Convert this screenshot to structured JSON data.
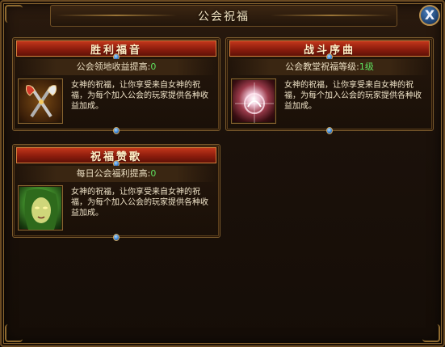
{
  "window": {
    "title": "公会祝福",
    "close_label": "X"
  },
  "panels": [
    {
      "title": "胜利福音",
      "stat_label": "公会领地收益提高:",
      "stat_value": "0",
      "description": "女神的祝福，让你享受来自女神的祝福，为每个加入公会的玩家提供各种收益加成。",
      "icon": "crossed-axes-icon"
    },
    {
      "title": "战斗序曲",
      "stat_label": "公会教堂祝福等级:",
      "stat_value": "1级",
      "description": "女神的祝福，让你享受来自女神的祝福，为每个加入公会的玩家提供各种收益加成。",
      "icon": "radiant-orb-icon"
    },
    {
      "title": "祝福赞歌",
      "stat_label": "每日公会福利提高:",
      "stat_value": "0",
      "description": "女神的祝福，让你享受来自女神的祝福，为每个加入公会的玩家提供各种收益加成。",
      "icon": "goddess-portrait-icon"
    }
  ],
  "colors": {
    "panel_header": "#a3260f",
    "stat_value": "#5fe05f",
    "border": "#8a6630"
  }
}
